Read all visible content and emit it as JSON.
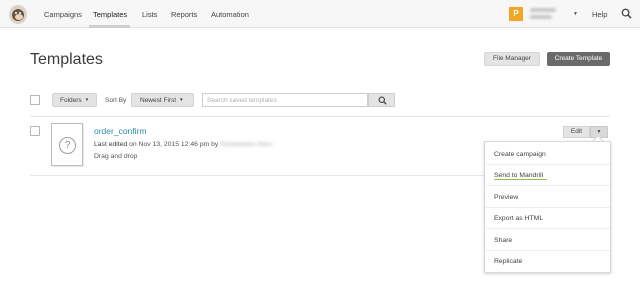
{
  "nav": {
    "items": [
      "Campaigns",
      "Templates",
      "Lists",
      "Reports",
      "Automation"
    ],
    "active": "Templates",
    "account_initial": "P",
    "help": "Help"
  },
  "header": {
    "title": "Templates",
    "file_manager": "File Manager",
    "create_template": "Create Template"
  },
  "toolbar": {
    "folders": "Folders",
    "sort_label": "Sort By",
    "sort_value": "Newest First",
    "search_placeholder": "Search saved templates"
  },
  "template": {
    "name": "order_confirm",
    "edited_label": "Last edited",
    "edited_date": "on Nov 13, 2015 12:46 pm by",
    "type": "Drag and drop",
    "edit": "Edit"
  },
  "dropdown": {
    "items": [
      "Create campaign",
      "Send to Mandrill",
      "Preview",
      "Export as HTML",
      "Share",
      "Replicate"
    ]
  },
  "colors": {
    "link": "#2a8ea8",
    "accent_badge": "#f1a627",
    "primary_button": "#6a6a6a",
    "highlight_underline": "#8bc34a"
  },
  "icons": [
    "mailchimp-logo-icon",
    "search-icon",
    "question-icon",
    "chevron-down-icon"
  ]
}
